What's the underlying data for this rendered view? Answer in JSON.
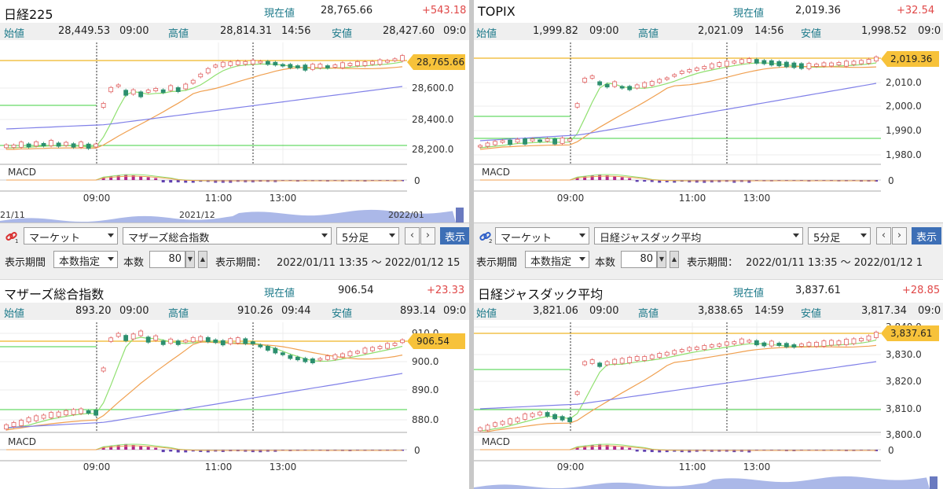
{
  "labels": {
    "open": "始値",
    "high": "高値",
    "low": "安値",
    "current": "現在値",
    "macd": "MACD",
    "period_label": "表示期間",
    "period_mode": "本数指定",
    "count_label": "本数",
    "range_label": "表示期間：",
    "show": "表示",
    "prev": "‹",
    "next": "›",
    "spin_down": "▼",
    "spin_up": "▲"
  },
  "colors": {
    "up": "#f5a0a0",
    "down": "#2c8f6e",
    "ma_fast": "#90e070",
    "ma_mid": "#f0a050",
    "ma_slow": "#8080e8",
    "price_tag": "#f7c23a",
    "change": "#e04848"
  },
  "panels": [
    {
      "title": "日経225",
      "current": "28,765.66",
      "change": "+543.18",
      "open": "28,449.53",
      "open_time": "09:00",
      "high": "28,814.31",
      "high_time": "14:56",
      "low": "28,427.60",
      "low_time": "09:0",
      "price_tag": "28,765.66",
      "y_ticks": [
        "28,600.0",
        "28,400.0",
        "28,200.0"
      ],
      "macd_zero": "0",
      "x_ticks": [
        "09:00",
        "11:00",
        "13:00"
      ],
      "overview_labels": [
        "21/11",
        "2021/12",
        "2022/01"
      ]
    },
    {
      "title": "TOPIX",
      "current": "2,019.36",
      "change": "+32.54",
      "open": "1,999.82",
      "open_time": "09:00",
      "high": "2,021.09",
      "high_time": "14:56",
      "low": "1,998.52",
      "low_time": "09:0",
      "price_tag": "2,019.36",
      "y_ticks": [
        "2,010.0",
        "2,000.0",
        "1,990.0",
        "1,980.0"
      ],
      "macd_zero": "0",
      "x_ticks": [
        "09:00",
        "11:00",
        "13:00"
      ],
      "overview_labels": []
    },
    {
      "link_index": "1",
      "market": "マーケット",
      "instrument": "マザーズ総合指数",
      "interval": "5分足",
      "count": "80",
      "period": "2022/01/11 13:35 ～ 2022/01/12 15",
      "title": "マザーズ総合指数",
      "current": "906.54",
      "change": "+23.33",
      "open": "893.20",
      "open_time": "09:00",
      "high": "910.26",
      "high_time": "09:44",
      "low": "893.14",
      "low_time": "09:0",
      "price_tag": "906.54",
      "y_ticks": [
        "910.0",
        "900.0",
        "890.0",
        "880.0"
      ],
      "macd_zero": "0",
      "x_ticks": [
        "09:00",
        "11:00",
        "13:00"
      ],
      "overview_labels": []
    },
    {
      "link_index": "2",
      "market": "マーケット",
      "instrument": "日経ジャスダック平均",
      "interval": "5分足",
      "count": "80",
      "period": "2022/01/11 13:35 ～ 2022/01/12 1",
      "title": "日経ジャスダック平均",
      "current": "3,837.61",
      "change": "+28.85",
      "open": "3,821.06",
      "open_time": "09:00",
      "high": "3,838.65",
      "high_time": "14:59",
      "low": "3,817.34",
      "low_time": "09:0",
      "price_tag": "3,837.61",
      "y_ticks": [
        "3,840.0",
        "3,830.0",
        "3,820.0",
        "3,810.0",
        "3,800.0"
      ],
      "macd_zero": "0",
      "x_ticks": [
        "09:00",
        "11:00",
        "13:00"
      ],
      "overview_labels": []
    }
  ]
}
